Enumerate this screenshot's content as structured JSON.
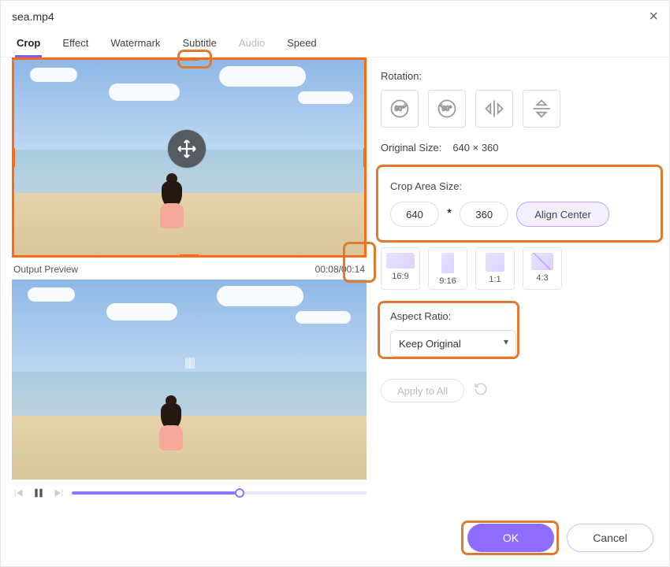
{
  "title": "sea.mp4",
  "tabs": [
    "Crop",
    "Effect",
    "Watermark",
    "Subtitle",
    "Audio",
    "Speed"
  ],
  "activeTab": "Crop",
  "disabledTab": "Audio",
  "outputPreviewLabel": "Output Preview",
  "timecode": "00:08/00:14",
  "rotationLabel": "Rotation:",
  "originalSizeLabel": "Original Size:",
  "originalSize": "640 × 360",
  "cropAreaLabel": "Crop Area Size:",
  "cropWidth": "640",
  "cropHeight": "360",
  "alignCenter": "Align Center",
  "ratios": [
    {
      "key": "16:9",
      "cls": "r169"
    },
    {
      "key": "9:16",
      "cls": "r916"
    },
    {
      "key": "1:1",
      "cls": "r11"
    },
    {
      "key": "4:3",
      "cls": "r43"
    }
  ],
  "aspectLabel": "Aspect Ratio:",
  "aspectValue": "Keep Original",
  "applyAll": "Apply to All",
  "ok": "OK",
  "cancel": "Cancel",
  "starSep": "*"
}
